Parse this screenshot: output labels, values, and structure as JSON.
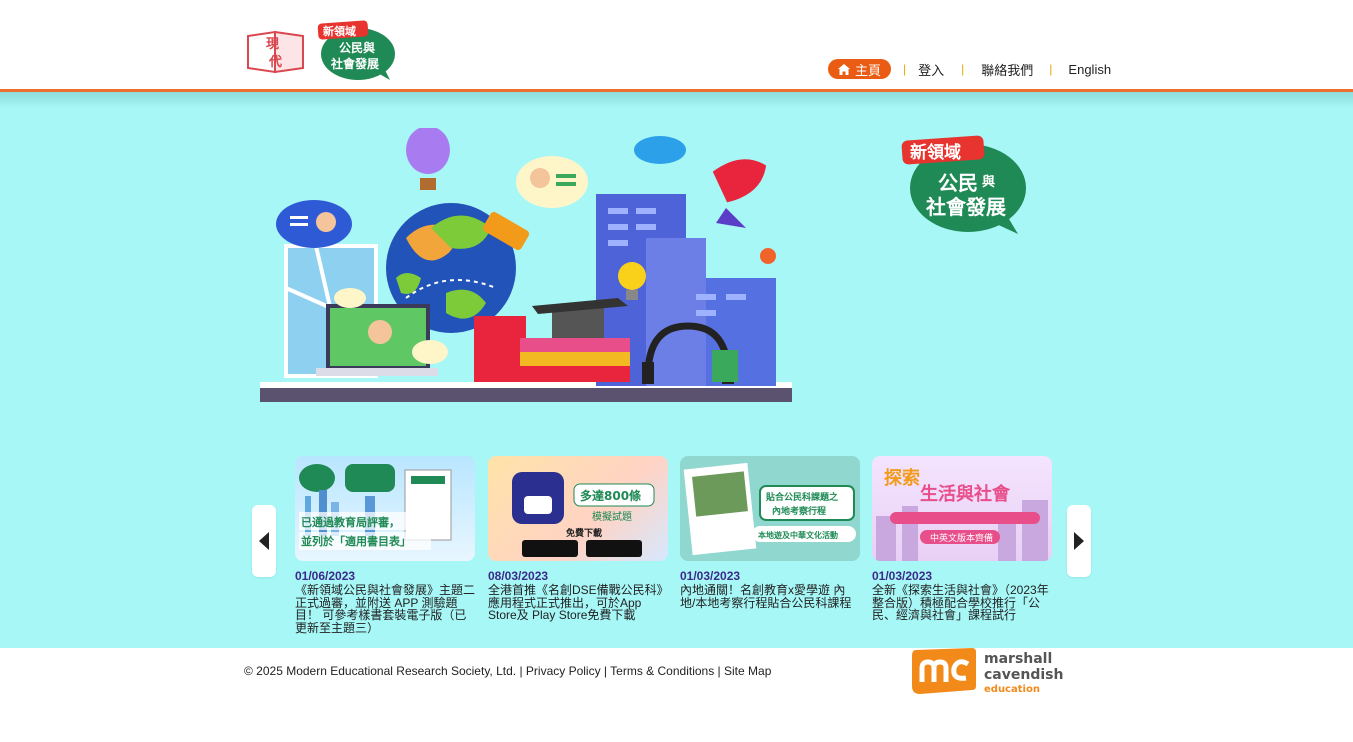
{
  "header": {
    "logo_modern_text": "現代",
    "logo_series_badge": "新領域",
    "logo_series_title_1": "公民與",
    "logo_series_title_2": "社會發展"
  },
  "nav": {
    "home": "主頁",
    "login": "登入",
    "contact": "聯絡我們",
    "english": "English",
    "separator": "|"
  },
  "hero": {
    "badge": "新領域",
    "title_1": "公民",
    "title_2": "與",
    "title_3": "社會發展"
  },
  "news": [
    {
      "date": "01/06/2023",
      "text": "《新領域公民與社會發展》主題二正式過審，並附送 APP 測驗題目！ 可參考樣書套裝電子版（已更新至主題三）",
      "img_line1": "已通過教育局評審，",
      "img_line2": "並列於「適用書目表」"
    },
    {
      "date": "08/03/2023",
      "text": "全港首推《名創DSE備戰公民科》應用程式正式推出，可於App Store及 Play Store免費下載",
      "img_line1": "多達800條",
      "img_line2": "模擬試題",
      "img_line3": "免費下載"
    },
    {
      "date": "01/03/2023",
      "text": "內地通關！名創教育x愛學遊 內地/本地考察行程貼合公民科課程",
      "img_line1": "貼合公民科課題之",
      "img_line2": "內地考察行程",
      "img_line3": "本地遊及中華文化活動"
    },
    {
      "date": "01/03/2023",
      "text": "全新《探索生活與社會》（2023年整合版）積極配合學校推行「公民、經濟與社會」課程試行",
      "img_line1": "探索",
      "img_line2": "生活與社會",
      "img_line3": "中英文版本齊備"
    }
  ],
  "footer": {
    "copyright": "© 2025 Modern Educational Research Society, Ltd.",
    "privacy": "Privacy Policy",
    "terms": "Terms & Conditions",
    "sitemap": "Site Map",
    "sep": " | ",
    "mc_1": "marshall",
    "mc_2": "cavendish",
    "mc_3": "education"
  },
  "colors": {
    "accent": "#ea5b13",
    "hero_bg": "#a7f7f7",
    "logo_green": "#1f8a55",
    "date_color": "#3c2a8a"
  },
  "icons": [
    "home-icon",
    "arrow-left-icon",
    "arrow-right-icon"
  ]
}
